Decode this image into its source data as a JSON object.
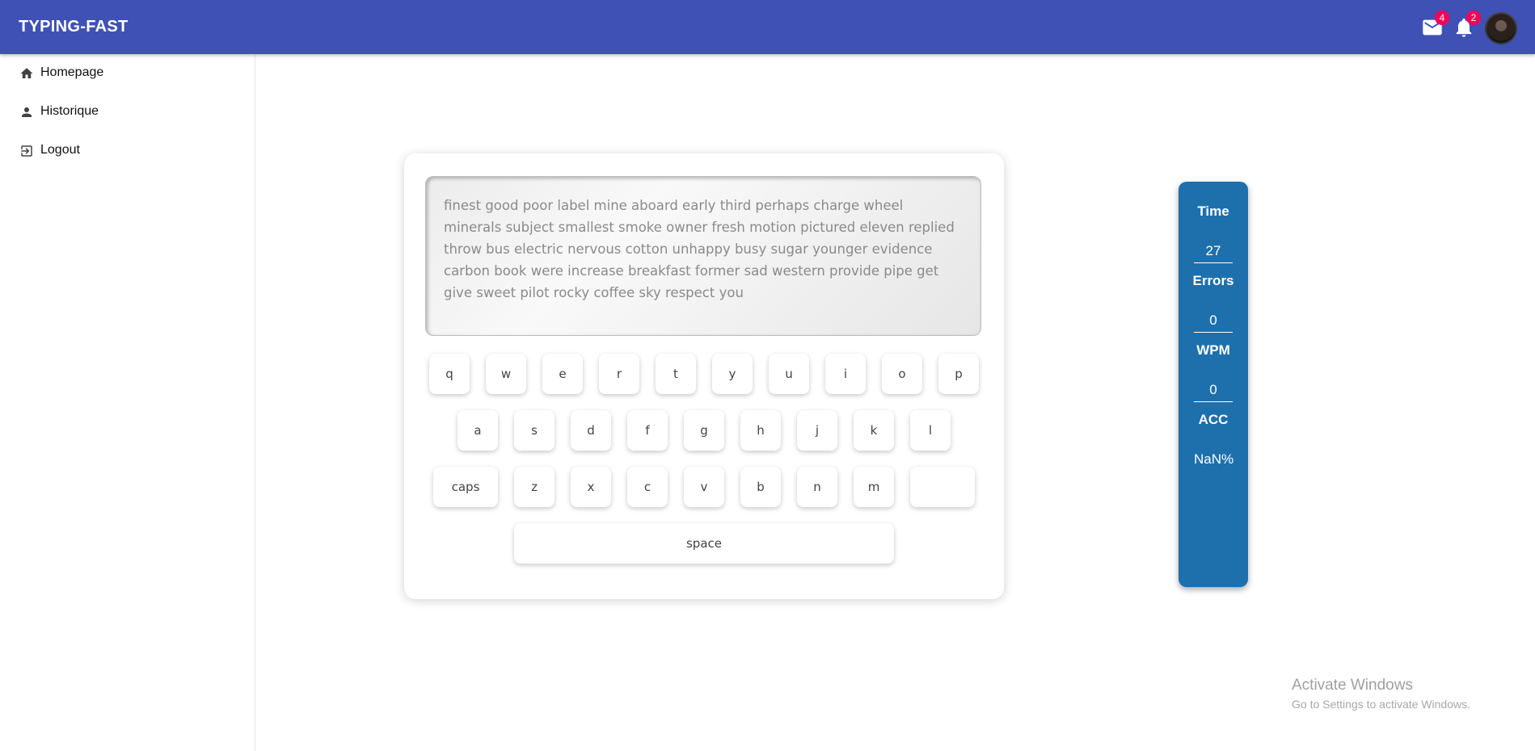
{
  "app": {
    "title": "TYPING-FAST",
    "accent_color": "#3f51b5",
    "badge_color": "#f50057"
  },
  "header": {
    "mail_icon": "mail-icon",
    "mail_badge": "4",
    "notifications_icon": "bell-icon",
    "notifications_badge": "2"
  },
  "sidebar": {
    "items": [
      {
        "label": "Homepage",
        "icon": "home-icon"
      },
      {
        "label": "Historique",
        "icon": "person-icon"
      },
      {
        "label": "Logout",
        "icon": "logout-icon"
      }
    ]
  },
  "typing": {
    "text": "finest good poor label mine aboard early third perhaps charge wheel minerals subject smallest smoke owner fresh motion pictured eleven replied throw bus electric nervous cotton unhappy busy sugar younger evidence carbon book were increase breakfast former sad western provide pipe get give sweet pilot rocky coffee sky respect you"
  },
  "keyboard": {
    "row1": [
      "q",
      "w",
      "e",
      "r",
      "t",
      "y",
      "u",
      "i",
      "o",
      "p"
    ],
    "row2": [
      "a",
      "s",
      "d",
      "f",
      "g",
      "h",
      "j",
      "k",
      "l"
    ],
    "row3": [
      "caps",
      "z",
      "x",
      "c",
      "v",
      "b",
      "n",
      "m",
      ""
    ],
    "space": "space"
  },
  "stats": {
    "panel_color": "#1e70ad",
    "time_label": "Time",
    "time_value": "27",
    "errors_label": "Errors",
    "errors_value": "0",
    "wpm_label": "WPM",
    "wpm_value": "0",
    "acc_label": "ACC",
    "acc_value": "NaN%"
  },
  "watermark": {
    "title": "Activate Windows",
    "subtitle": "Go to Settings to activate Windows."
  }
}
